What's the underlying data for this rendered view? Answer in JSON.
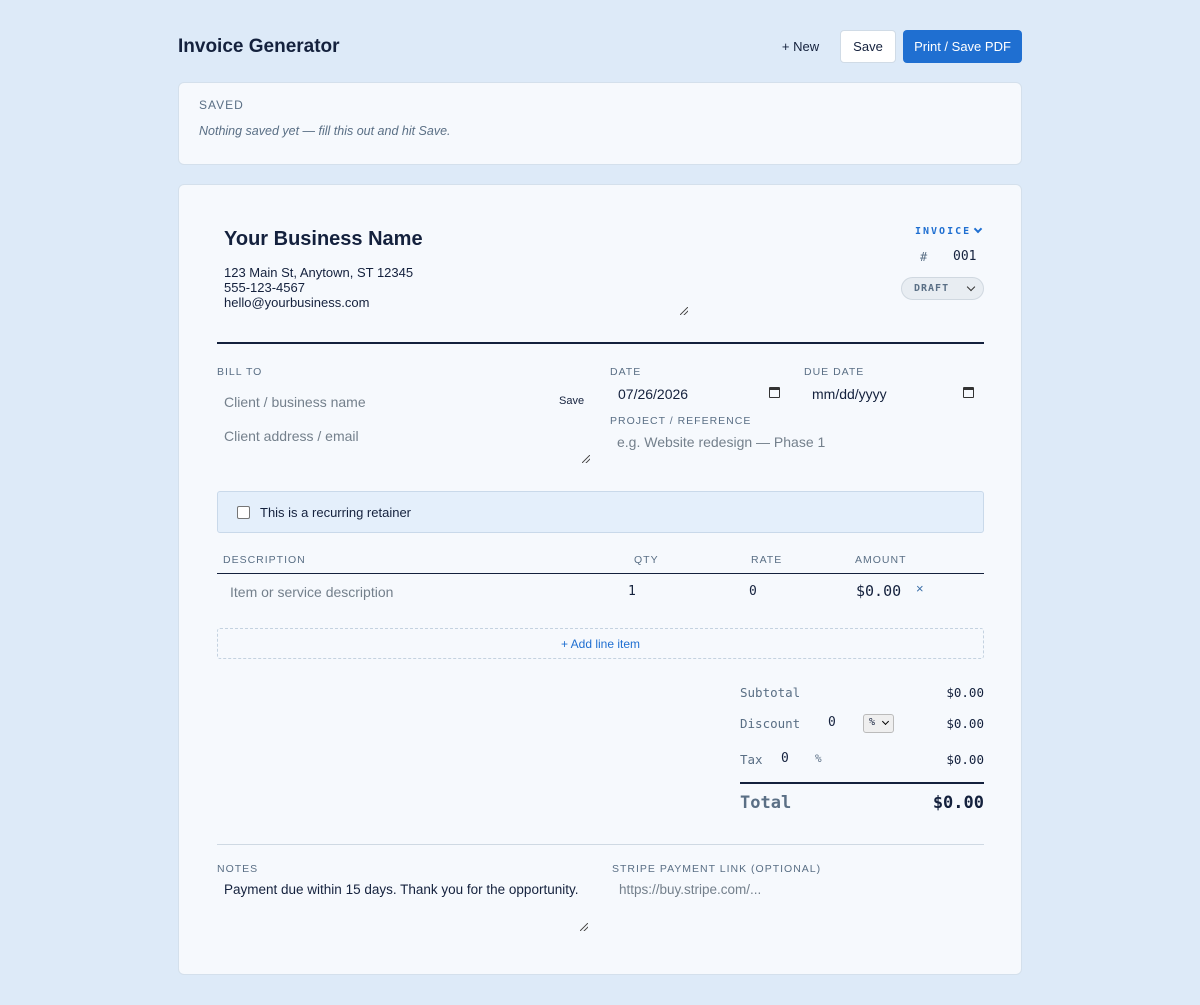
{
  "header": {
    "title": "Invoice Generator",
    "new_label": "+ New",
    "save_label": "Save",
    "print_label": "Print / Save PDF"
  },
  "saved": {
    "heading": "SAVED",
    "empty_note": "Nothing saved yet — fill this out and hit Save."
  },
  "business": {
    "name": "Your Business Name",
    "details": "123 Main St, Anytown, ST 12345\n555-123-4567\nhello@yourbusiness.com"
  },
  "doc": {
    "type": "INVOICE",
    "number_prefix": "#",
    "number": "001",
    "status": "DRAFT"
  },
  "bill_to": {
    "label": "BILL TO",
    "name_placeholder": "Client / business name",
    "save_client_label": "Save",
    "address_placeholder": "Client address / email"
  },
  "dates": {
    "date_label": "DATE",
    "date_value": "07/26/2026",
    "due_label": "DUE DATE",
    "due_value": "mm/dd/yyyy"
  },
  "project": {
    "label": "PROJECT / REFERENCE",
    "placeholder": "e.g. Website redesign — Phase 1"
  },
  "recurring": {
    "label": "This is a recurring retainer",
    "checked": false
  },
  "items": {
    "columns": [
      "DESCRIPTION",
      "QTY",
      "RATE",
      "AMOUNT"
    ],
    "rows": [
      {
        "description_placeholder": "Item or service description",
        "qty": "1",
        "rate": "0",
        "amount": "$0.00",
        "remove": "×"
      }
    ],
    "add_label": "+ Add line item"
  },
  "totals": {
    "subtotal_label": "Subtotal",
    "subtotal": "$0.00",
    "discount_label": "Discount",
    "discount_value": "0",
    "discount_unit": "%",
    "discount": "$0.00",
    "tax_label": "Tax",
    "tax_value": "0",
    "tax_unit": "%",
    "tax": "$0.00",
    "total_label": "Total",
    "total": "$0.00"
  },
  "notes": {
    "label": "NOTES",
    "value": "Payment due within 15 days. Thank you for the opportunity."
  },
  "stripe": {
    "label": "STRIPE PAYMENT LINK (OPTIONAL)",
    "placeholder": "https://buy.stripe.com/..."
  }
}
